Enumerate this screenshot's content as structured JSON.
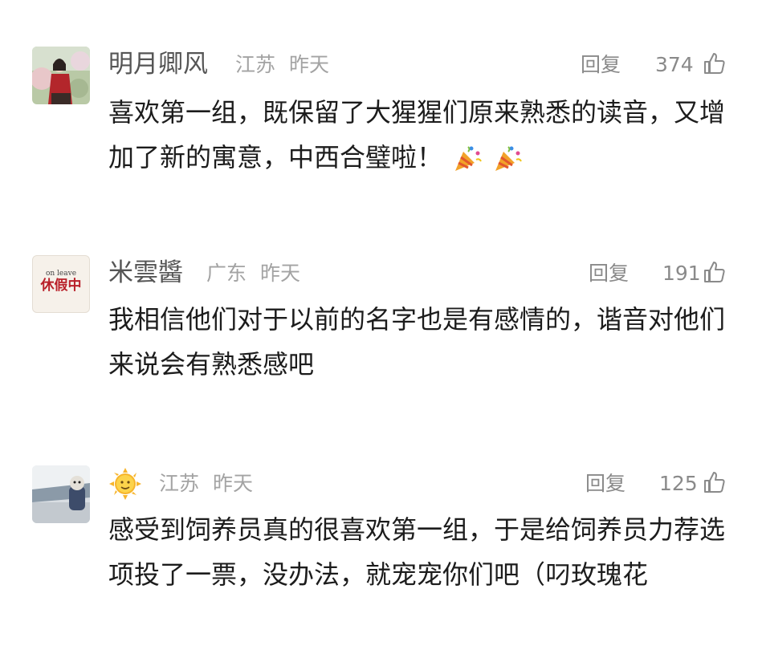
{
  "comments": [
    {
      "user": "明月卿风",
      "location": "江苏",
      "time": "昨天",
      "reply": "回复",
      "likes": "374",
      "text": "喜欢第一组，既保留了大猩猩们原来熟悉的读音，又增加了新的寓意，中西合璧啦！",
      "emojis": [
        "party-popper-emoji",
        "party-popper-emoji"
      ]
    },
    {
      "user": "米雲醬",
      "location": "广东",
      "time": "昨天",
      "reply": "回复",
      "likes": "191",
      "text": "我相信他们对于以前的名字也是有感情的，谐音对他们来说会有熟悉感吧",
      "avatar_text_top": "on leave",
      "avatar_text_main": "休假中"
    },
    {
      "user_icon": "sun-face-icon",
      "location": "江苏",
      "time": "昨天",
      "reply": "回复",
      "likes": "125",
      "text": "感受到饲养员真的很喜欢第一组，于是给饲养员力荐选项投了一票，没办法，就宠宠你们吧（叼玫瑰花"
    }
  ],
  "icons": {
    "like": "thumbs-up-icon"
  },
  "colors": {
    "meta": "#a3a3a3",
    "action": "#8a8a8a",
    "text": "#1c1c1c",
    "name": "#555555"
  }
}
